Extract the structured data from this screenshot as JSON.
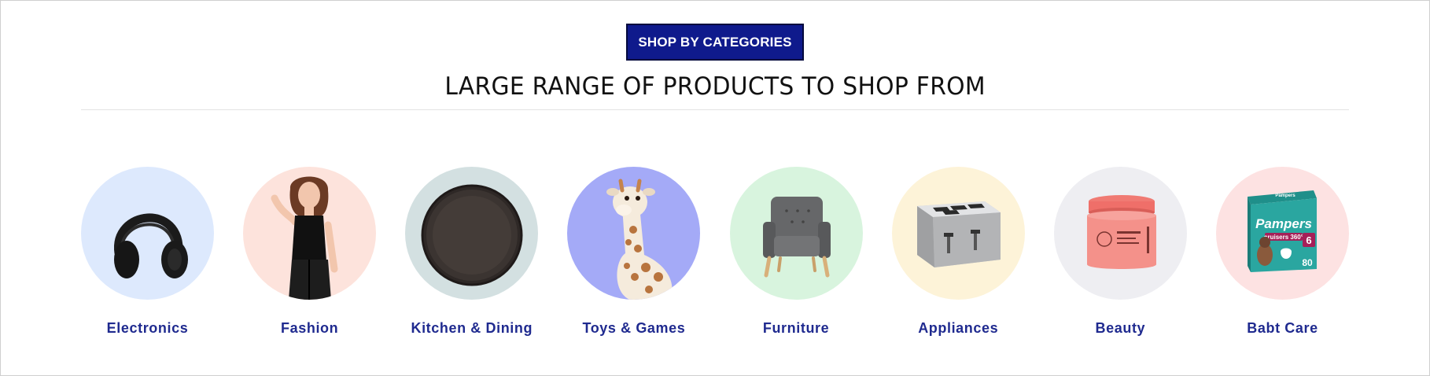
{
  "header": {
    "badge": "SHOP BY CATEGORIES",
    "title": "LARGE RANGE OF PRODUCTS TO SHOP FROM"
  },
  "categories": [
    {
      "label": "Electronics",
      "bg": "#dde9fd",
      "icon": "headphones-icon"
    },
    {
      "label": "Fashion",
      "bg": "#fde3dc",
      "icon": "fashion-model-icon"
    },
    {
      "label": "Kitchen & Dining",
      "bg": "#d3e0e1",
      "icon": "plate-icon"
    },
    {
      "label": "Toys & Games",
      "bg": "#a4aaf7",
      "icon": "giraffe-toy-icon"
    },
    {
      "label": "Furniture",
      "bg": "#d8f4de",
      "icon": "armchair-icon"
    },
    {
      "label": "Appliances",
      "bg": "#fdf3d8",
      "icon": "toaster-icon"
    },
    {
      "label": "Beauty",
      "bg": "#eeeef2",
      "icon": "cosmetic-jar-icon"
    },
    {
      "label": "Babt Care",
      "bg": "#fde2e2",
      "icon": "diaper-box-icon"
    }
  ],
  "product_text": {
    "diaper_brand": "Pampers",
    "diaper_line": "cruisers 360°",
    "diaper_size": "6",
    "diaper_count": "80"
  }
}
